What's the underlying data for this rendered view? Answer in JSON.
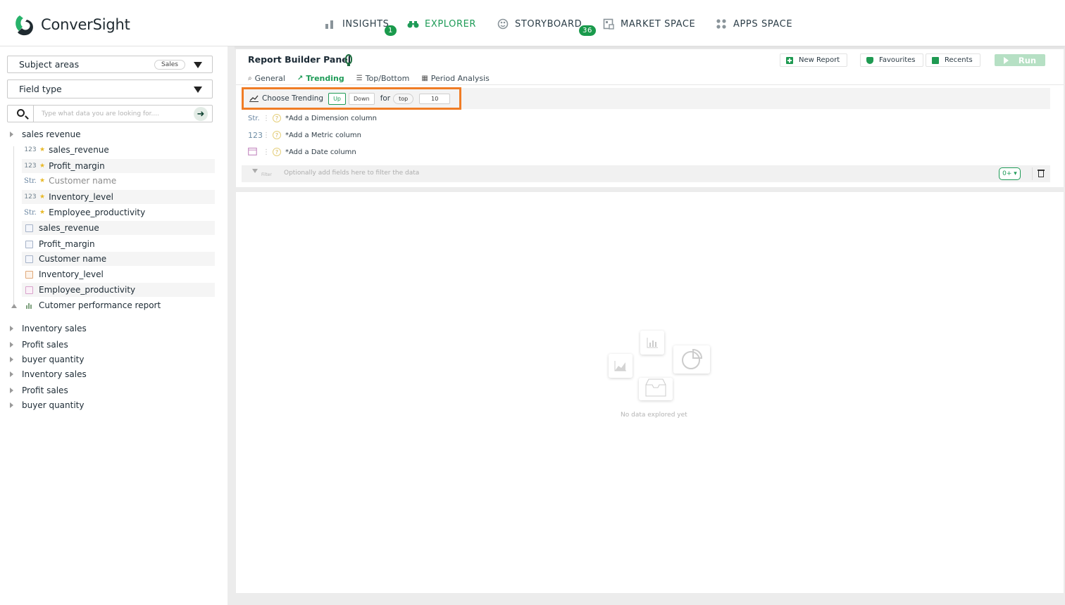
{
  "app": {
    "name": "ConverSight"
  },
  "nav": {
    "items": [
      {
        "label": "INSIGHTS",
        "icon": "bar-chart-icon",
        "badge": "1"
      },
      {
        "label": "EXPLORER",
        "icon": "binoculars-icon",
        "active": true
      },
      {
        "label": "STORYBOARD",
        "icon": "palette-icon",
        "badge": "36"
      },
      {
        "label": "MARKET SPACE",
        "icon": "market-icon"
      },
      {
        "label": "APPS SPACE",
        "icon": "apps-grid-icon"
      }
    ]
  },
  "sidebar": {
    "subject_areas": {
      "label": "Subject areas",
      "pill": "Sales"
    },
    "field_type": {
      "label": "Field type"
    },
    "search": {
      "placeholder": "Type what data you are looking for...."
    },
    "tree_root": "sales revenue",
    "fields": [
      {
        "type": "123",
        "starred": true,
        "label": "sales_revenue"
      },
      {
        "type": "123",
        "starred": true,
        "label": "Profit_margin"
      },
      {
        "type": "Str.",
        "starred": true,
        "label": "Customer name",
        "muted": true
      },
      {
        "type": "123",
        "starred": true,
        "label": "Inventory_level"
      },
      {
        "type": "Str.",
        "starred": true,
        "label": "Employee_productivity"
      },
      {
        "type": "report",
        "label": "sales_revenue"
      },
      {
        "type": "report",
        "label": "Profit_margin"
      },
      {
        "type": "report",
        "label": "Customer name"
      },
      {
        "type": "report",
        "label": "Inventory_level"
      },
      {
        "type": "report",
        "label": "Employee_productivity"
      },
      {
        "type": "chart",
        "label": "Cutomer performance report"
      }
    ],
    "groups": [
      "Inventory sales",
      "Profit sales",
      "buyer quantity",
      "Inventory sales",
      "Profit sales",
      "buyer quantity"
    ]
  },
  "panel": {
    "title": "Report Builder Panel",
    "actions": {
      "new_report": "New Report",
      "favourites": "Favourites",
      "recents": "Recents",
      "run": "Run"
    },
    "tabs": [
      "General",
      "Trending",
      "Top/Bottom",
      "Period Analysis"
    ],
    "active_tab": "Trending",
    "trending": {
      "label": "Choose Trending",
      "up": "Up",
      "down": "Down",
      "for": "for",
      "scope": "top",
      "count": "10"
    },
    "columns": [
      {
        "type": "Str.",
        "label": "*Add a Dimension column"
      },
      {
        "type": "123",
        "label": "*Add a Metric column"
      },
      {
        "type": "date",
        "label": "*Add a Date column"
      }
    ],
    "filter": {
      "label": "Filter",
      "placeholder": "Optionally add fields here to filter the data",
      "count": "0+ ▾"
    }
  },
  "results": {
    "empty_text": "No data explored yet"
  },
  "colors": {
    "brand_green": "#1e9b57",
    "highlight_orange": "#f07c25"
  }
}
